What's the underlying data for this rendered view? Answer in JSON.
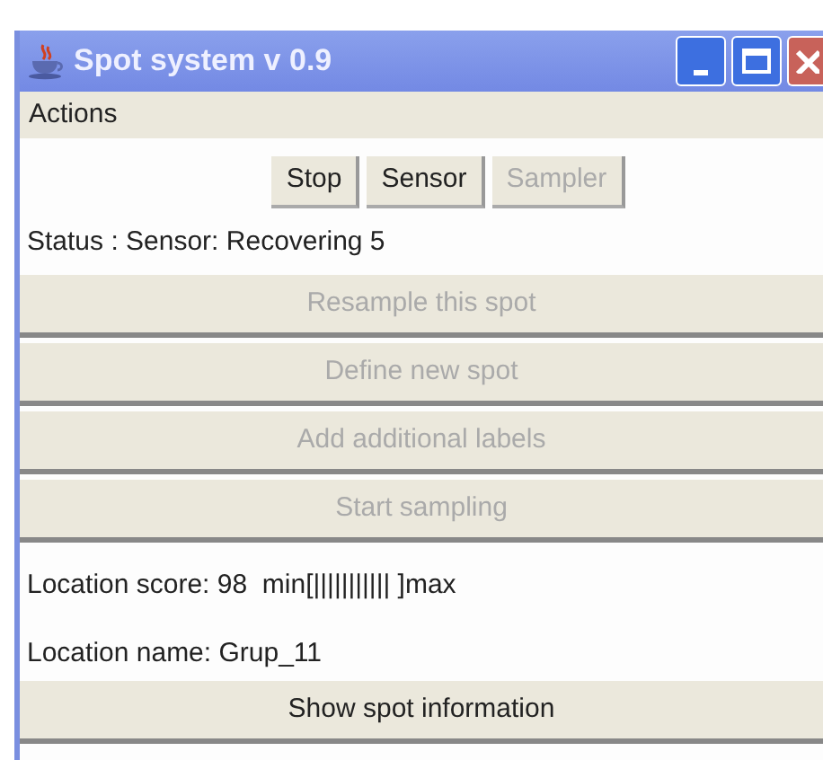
{
  "window": {
    "title": "Spot system v 0.9"
  },
  "menu": [
    "Actions"
  ],
  "top_buttons": [
    {
      "label": "Stop",
      "disabled": false
    },
    {
      "label": "Sensor",
      "disabled": false
    },
    {
      "label": "Sampler",
      "disabled": true
    }
  ],
  "status": "Status : Sensor: Recovering 5",
  "action_buttons": [
    {
      "label": "Resample this spot",
      "disabled": true
    },
    {
      "label": "Define new spot",
      "disabled": true
    },
    {
      "label": "Add additional labels",
      "disabled": true
    },
    {
      "label": "Start sampling",
      "disabled": true
    }
  ],
  "location_score": "Location score: 98  min[||||||||||| ]max",
  "location_name": "Location name: Grup_11",
  "bottom_button": {
    "label": "Show spot information",
    "disabled": false
  }
}
